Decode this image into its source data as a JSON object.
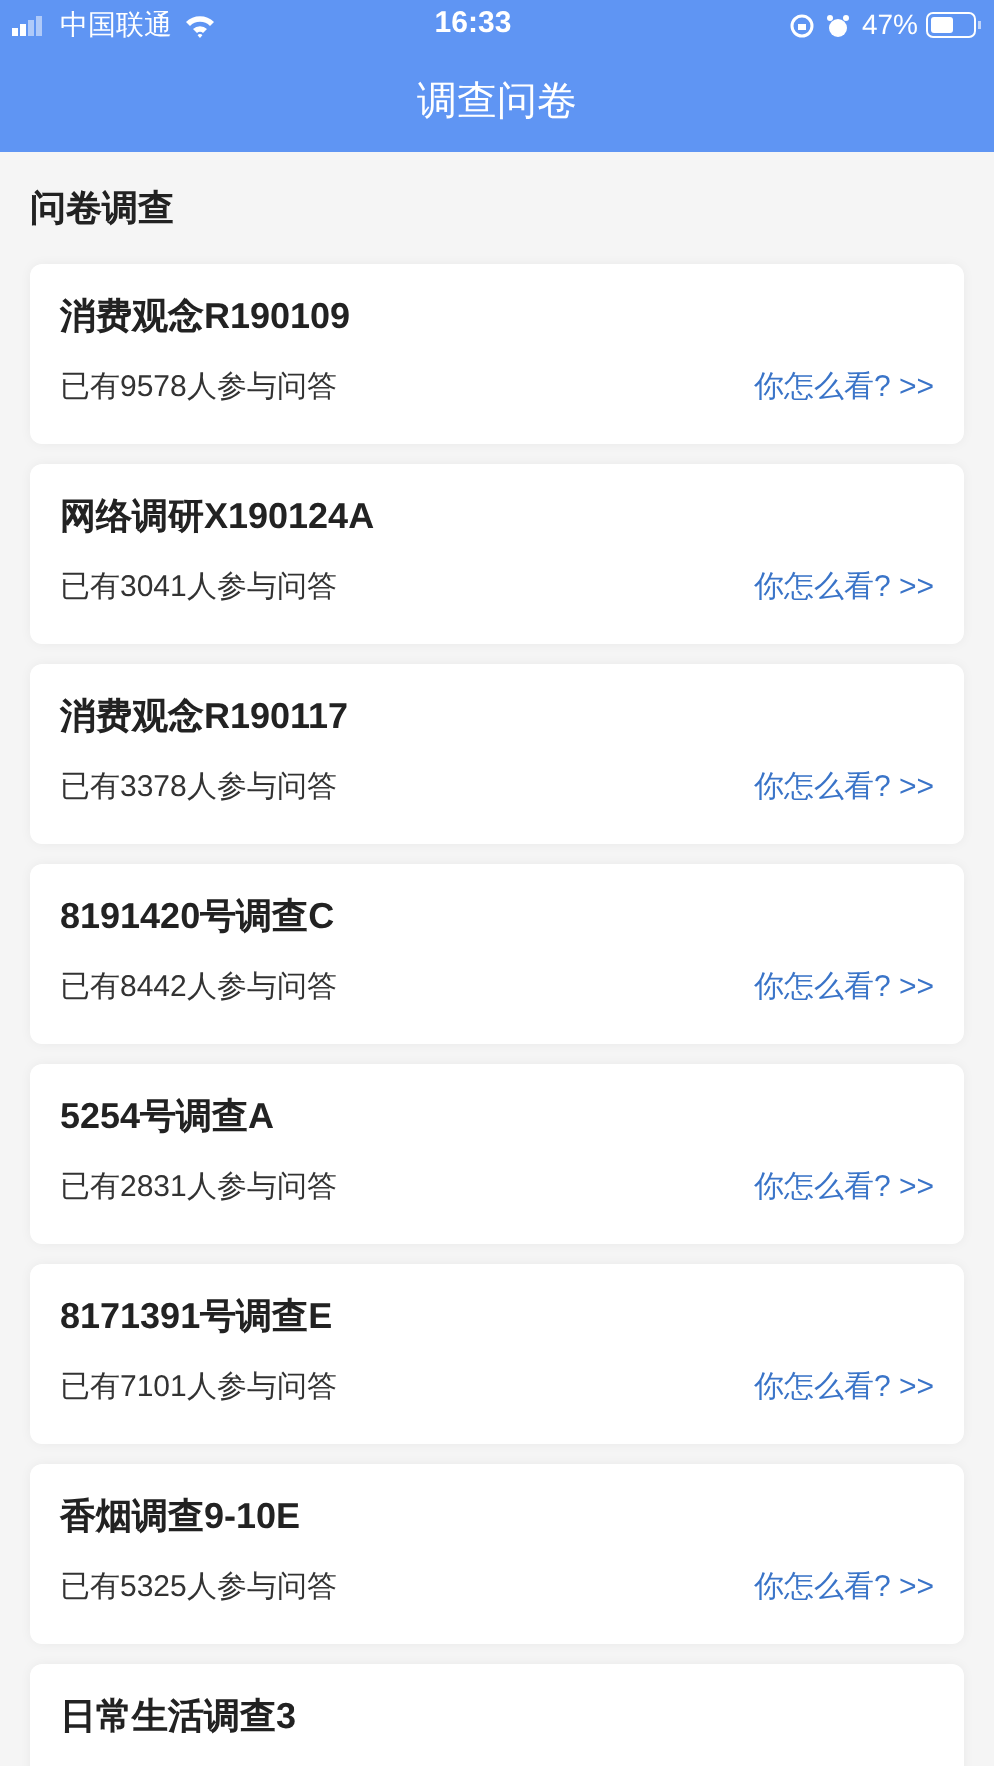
{
  "status_bar": {
    "carrier": "中国联通",
    "time": "16:33",
    "battery": "47%"
  },
  "header": {
    "title": "调查问卷"
  },
  "section": {
    "title": "问卷调查"
  },
  "surveys": [
    {
      "title": "消费观念R190109",
      "participants": "已有9578人参与问答",
      "link": "你怎么看? >>"
    },
    {
      "title": "网络调研X190124A",
      "participants": "已有3041人参与问答",
      "link": "你怎么看? >>"
    },
    {
      "title": "消费观念R190117",
      "participants": "已有3378人参与问答",
      "link": "你怎么看? >>"
    },
    {
      "title": "8191420号调查C",
      "participants": "已有8442人参与问答",
      "link": "你怎么看? >>"
    },
    {
      "title": "5254号调查A",
      "participants": "已有2831人参与问答",
      "link": "你怎么看? >>"
    },
    {
      "title": "8171391号调查E",
      "participants": "已有7101人参与问答",
      "link": "你怎么看? >>"
    },
    {
      "title": "香烟调查9-10E",
      "participants": "已有5325人参与问答",
      "link": "你怎么看? >>"
    },
    {
      "title": "日常生活调查3"
    }
  ]
}
